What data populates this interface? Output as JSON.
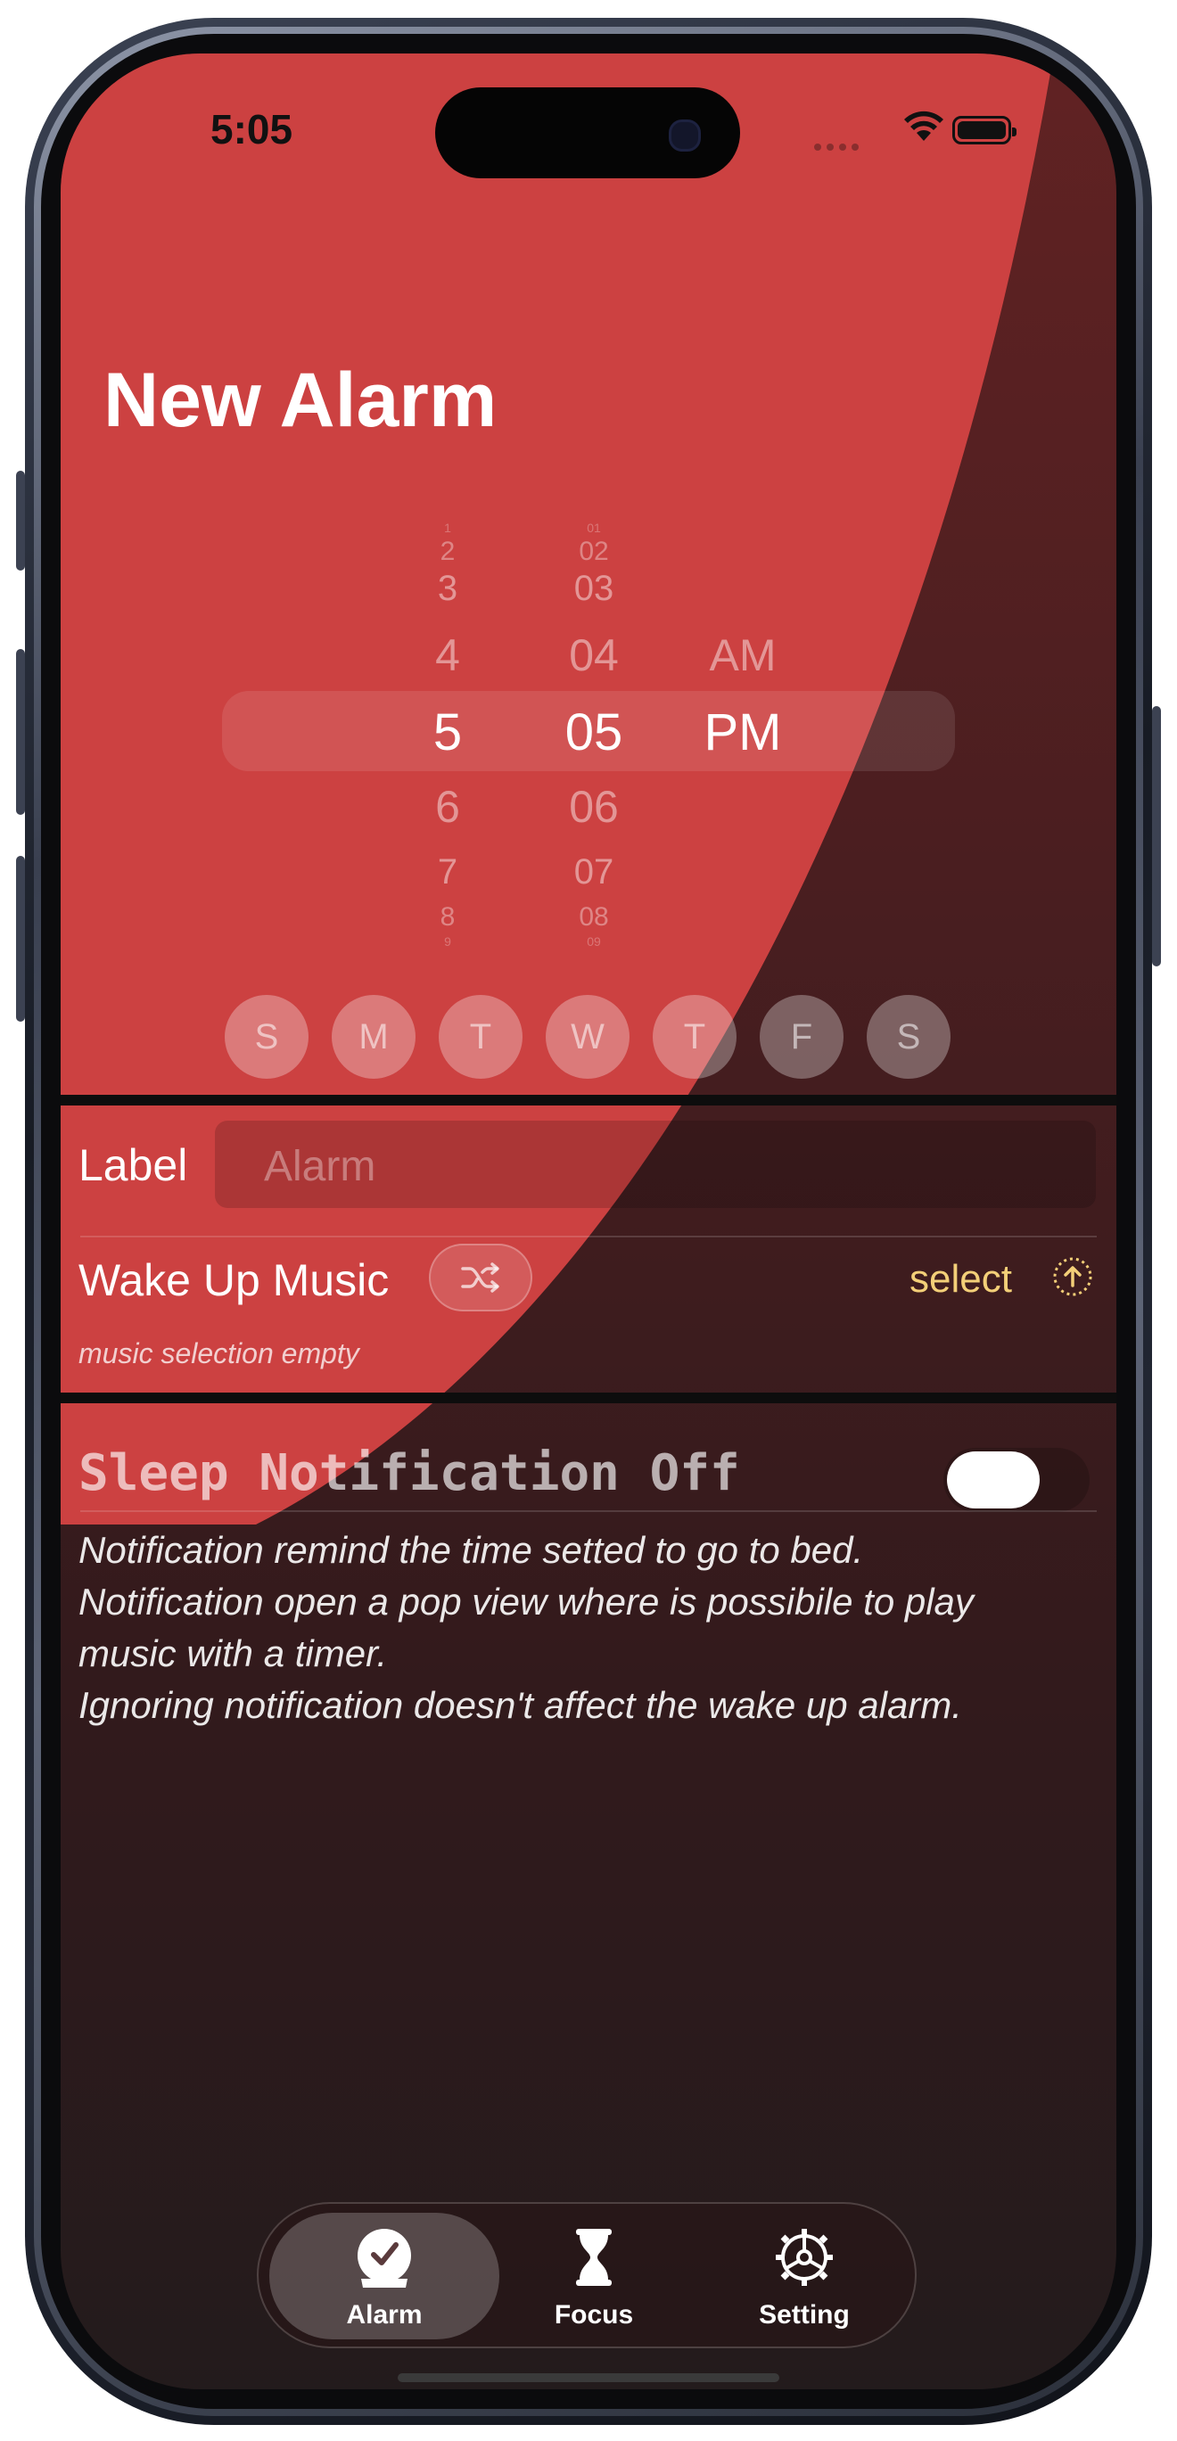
{
  "status": {
    "time": "5:05"
  },
  "header": {
    "title": "New Alarm"
  },
  "picker": {
    "hours": [
      "1",
      "2",
      "3",
      "4",
      "5",
      "6",
      "7",
      "8",
      "9"
    ],
    "minutes": [
      "01",
      "02",
      "03",
      "04",
      "05",
      "06",
      "07",
      "08",
      "09"
    ],
    "periods": [
      "AM",
      "PM"
    ],
    "selected_hour": "5",
    "selected_minute": "05",
    "selected_period": "PM"
  },
  "days": [
    "S",
    "M",
    "T",
    "W",
    "T",
    "F",
    "S"
  ],
  "label_row": {
    "label": "Label",
    "placeholder": "Alarm"
  },
  "music_row": {
    "label": "Wake Up Music",
    "select_label": "select",
    "hint": "music selection empty"
  },
  "sleep": {
    "title": "Sleep Notification Off",
    "description": [
      "Notification remind the time setted to go to bed.",
      "Notification open a pop view where is possibile to play",
      "music with a timer.",
      "Ignoring notification doesn't affect the wake up alarm."
    ]
  },
  "tabs": [
    {
      "label": "Alarm",
      "icon": "alarm-check-icon"
    },
    {
      "label": "Focus",
      "icon": "hourglass-icon"
    },
    {
      "label": "Setting",
      "icon": "gear-icon"
    }
  ],
  "colors": {
    "accent_red": "#cc4141",
    "select_yellow": "#f3cf78"
  }
}
